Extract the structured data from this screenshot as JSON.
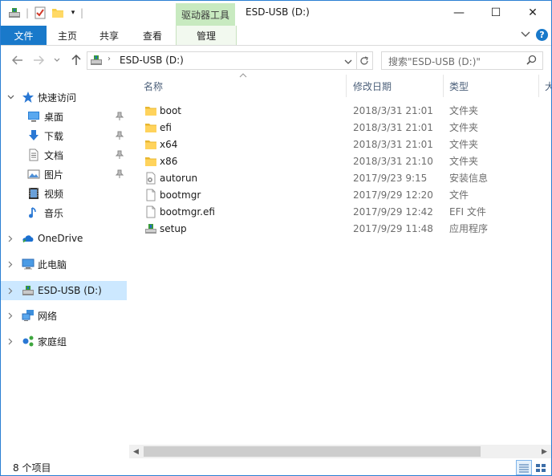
{
  "titlebar": {
    "context_tab": "驱动器工具",
    "title": "ESD-USB (D:)",
    "minimize": "—",
    "maximize": "☐",
    "close": "✕"
  },
  "ribbon": {
    "tabs": [
      {
        "label": "文件"
      },
      {
        "label": "主页"
      },
      {
        "label": "共享"
      },
      {
        "label": "查看"
      },
      {
        "label": "管理"
      }
    ],
    "help_label": "?"
  },
  "address": {
    "path": "ESD-USB (D:)",
    "search_placeholder": "搜索\"ESD-USB (D:)\""
  },
  "nav": {
    "quick_access": "快速访问",
    "pinned": [
      {
        "label": "桌面",
        "icon": "desktop-icon"
      },
      {
        "label": "下载",
        "icon": "download-icon"
      },
      {
        "label": "文档",
        "icon": "document-icon"
      },
      {
        "label": "图片",
        "icon": "picture-icon"
      }
    ],
    "libraries": [
      {
        "label": "视频",
        "icon": "video-icon"
      },
      {
        "label": "音乐",
        "icon": "music-icon"
      }
    ],
    "onedrive": "OneDrive",
    "this_pc": "此电脑",
    "usb": "ESD-USB (D:)",
    "network": "网络",
    "homegroup": "家庭组"
  },
  "columns": {
    "name": "名称",
    "modified": "修改日期",
    "type": "类型",
    "size": "大"
  },
  "files": [
    {
      "name": "boot",
      "date": "2018/3/31 21:01",
      "type": "文件夹",
      "icon": "folder-icon"
    },
    {
      "name": "efi",
      "date": "2018/3/31 21:01",
      "type": "文件夹",
      "icon": "folder-icon"
    },
    {
      "name": "x64",
      "date": "2018/3/31 21:01",
      "type": "文件夹",
      "icon": "folder-icon"
    },
    {
      "name": "x86",
      "date": "2018/3/31 21:10",
      "type": "文件夹",
      "icon": "folder-icon"
    },
    {
      "name": "autorun",
      "date": "2017/9/23 9:15",
      "type": "安装信息",
      "icon": "settings-file-icon"
    },
    {
      "name": "bootmgr",
      "date": "2017/9/29 12:20",
      "type": "文件",
      "icon": "blank-file-icon"
    },
    {
      "name": "bootmgr.efi",
      "date": "2017/9/29 12:42",
      "type": "EFI 文件",
      "icon": "blank-file-icon"
    },
    {
      "name": "setup",
      "date": "2017/9/29 11:48",
      "type": "应用程序",
      "icon": "setup-app-icon"
    }
  ],
  "status": {
    "count": "8 个项目"
  }
}
